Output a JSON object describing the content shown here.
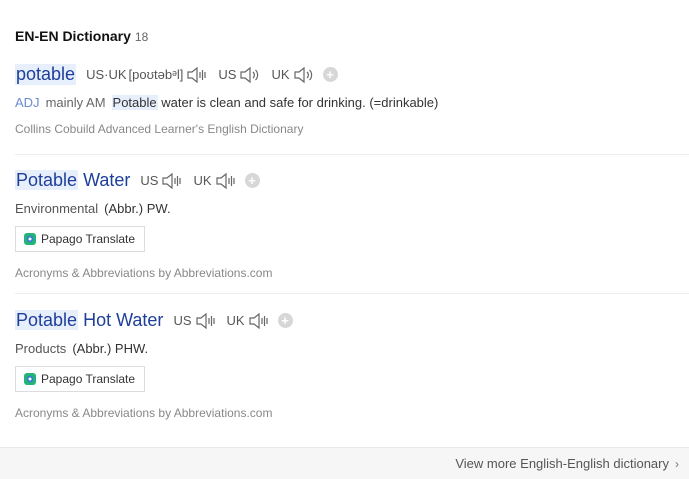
{
  "section": {
    "title": "EN-EN Dictionary",
    "count": "18"
  },
  "entries": [
    {
      "headword": "potable",
      "pron_label_1": "US·UK",
      "phonetic": "[poʊtəbᵊl]",
      "pron_label_2": "US",
      "pron_label_3": "UK",
      "plus": "+",
      "pos": "ADJ",
      "usage": "mainly AM",
      "def_highlight": "Potable",
      "def_rest": "water is clean and safe for drinking. (=drinkable)",
      "source": "Collins Cobuild Advanced Learner's English Dictionary"
    },
    {
      "headword_highlight": "Potable",
      "headword_rest": "Water",
      "pron_label_1": "US",
      "pron_label_2": "UK",
      "plus": "+",
      "category": "Environmental",
      "definition": "(Abbr.) PW.",
      "translate_label": "Papago Translate",
      "source": "Acronyms & Abbreviations by Abbreviations.com"
    },
    {
      "headword_highlight": "Potable",
      "headword_rest": "Hot Water",
      "pron_label_1": "US",
      "pron_label_2": "UK",
      "plus": "+",
      "category": "Products",
      "definition": "(Abbr.) PHW.",
      "translate_label": "Papago Translate",
      "source": "Acronyms & Abbreviations by Abbreviations.com"
    }
  ],
  "footer": {
    "more_label": "View more English-English dictionary",
    "chevron": "›"
  },
  "icons": {
    "speaker": "speaker-icon",
    "plus": "add-icon",
    "papago": "papago-logo-icon"
  },
  "colors": {
    "headword": "#1e3f9a",
    "highlight": "#e7eefc",
    "pos": "#6c8bcf"
  }
}
